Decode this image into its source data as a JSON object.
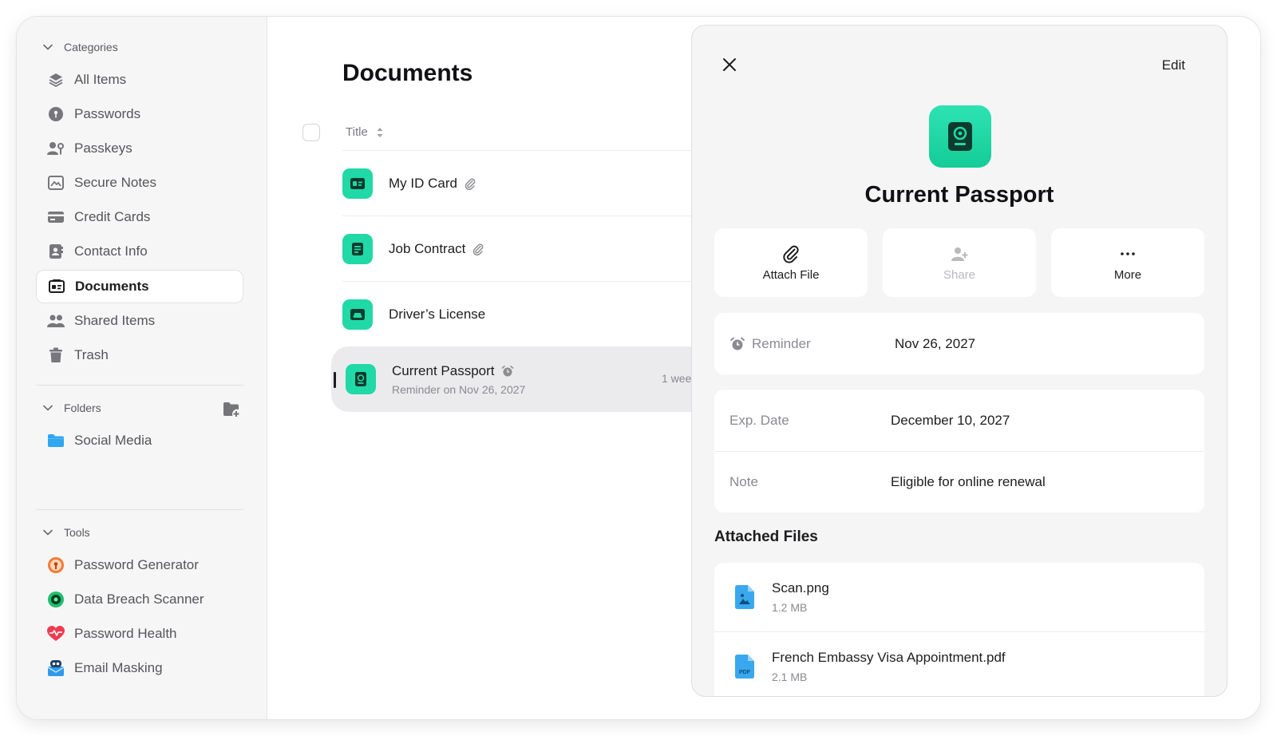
{
  "sidebar": {
    "categories_label": "Categories",
    "items": [
      {
        "label": "All Items"
      },
      {
        "label": "Passwords"
      },
      {
        "label": "Passkeys"
      },
      {
        "label": "Secure Notes"
      },
      {
        "label": "Credit Cards"
      },
      {
        "label": "Contact Info"
      },
      {
        "label": "Documents"
      },
      {
        "label": "Shared Items"
      },
      {
        "label": "Trash"
      }
    ],
    "folders_label": "Folders",
    "folders": [
      {
        "label": "Social Media"
      }
    ],
    "tools_label": "Tools",
    "tools": [
      {
        "label": "Password Generator"
      },
      {
        "label": "Data Breach Scanner"
      },
      {
        "label": "Password Health"
      },
      {
        "label": "Email Masking"
      }
    ]
  },
  "list": {
    "title": "Documents",
    "column_title": "Title",
    "rows": [
      {
        "title": "My ID Card"
      },
      {
        "title": "Job Contract"
      },
      {
        "title": "Driver’s License"
      },
      {
        "title": "Current Passport",
        "subtitle": "Reminder on Nov 26, 2027",
        "time": "1 wee"
      }
    ]
  },
  "detail": {
    "edit_label": "Edit",
    "title": "Current Passport",
    "actions": {
      "attach": "Attach File",
      "share": "Share",
      "more": "More"
    },
    "reminder": {
      "label": "Reminder",
      "value": "Nov 26, 2027"
    },
    "exp_date": {
      "label": "Exp. Date",
      "value": "December 10, 2027"
    },
    "note": {
      "label": "Note",
      "value": "Eligible for online renewal"
    },
    "files_title": "Attached Files",
    "files": [
      {
        "name": "Scan.png",
        "size": "1.2 MB"
      },
      {
        "name": "French Embassy Visa Appointment.pdf",
        "size": "2.1 MB"
      }
    ]
  },
  "colors": {
    "accent": "#20d9a6",
    "selected_row": "#ebebed",
    "sidebar_bg": "#f6f6f7",
    "panel_bg": "#f5f5f6"
  }
}
